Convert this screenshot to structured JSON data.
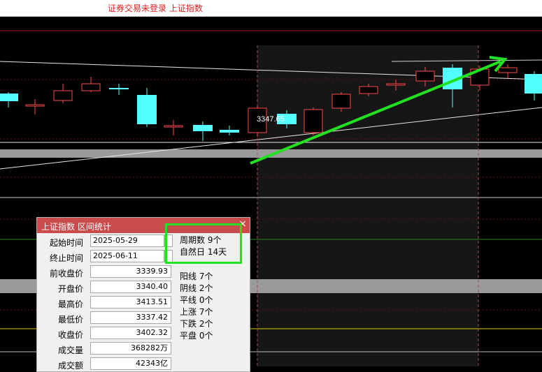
{
  "topbar": {
    "title": "证券交易未登录   上证指数"
  },
  "chart": {
    "price_label": "3347.65",
    "colors": {
      "up": "#ff4a4a",
      "down": "#54ffff",
      "highlight": "#161616",
      "arrow": "#22e022"
    },
    "candles": [
      {
        "dir": "down",
        "kind": "solid"
      },
      {
        "dir": "up",
        "kind": "hollow"
      },
      {
        "dir": "up",
        "kind": "hollow"
      },
      {
        "dir": "up",
        "kind": "hollow"
      },
      {
        "dir": "down",
        "kind": "solid"
      },
      {
        "dir": "down",
        "kind": "solid"
      },
      {
        "dir": "up",
        "kind": "hollow"
      },
      {
        "dir": "down",
        "kind": "solid"
      },
      {
        "dir": "down",
        "kind": "solid"
      },
      {
        "dir": "up",
        "kind": "hollow"
      },
      {
        "dir": "down",
        "kind": "solid"
      },
      {
        "dir": "up",
        "kind": "hollow"
      },
      {
        "dir": "up",
        "kind": "hollow"
      },
      {
        "dir": "up",
        "kind": "hollow"
      },
      {
        "dir": "up",
        "kind": "hollow"
      },
      {
        "dir": "up",
        "kind": "hollow"
      },
      {
        "dir": "down",
        "kind": "solid"
      },
      {
        "dir": "up",
        "kind": "hollow"
      },
      {
        "dir": "up",
        "kind": "hollow"
      },
      {
        "dir": "down",
        "kind": "solid"
      }
    ]
  },
  "dialog": {
    "title": "上证指数 区间统计",
    "close": "×",
    "fields": [
      {
        "label": "起始时间",
        "value": "2025-05-29",
        "type": "date"
      },
      {
        "label": "终止时间",
        "value": "2025-06-11",
        "type": "date"
      },
      {
        "label": "前收盘价",
        "value": "3339.93"
      },
      {
        "label": "开盘价",
        "value": "3340.40"
      },
      {
        "label": "最高价",
        "value": "3413.51"
      },
      {
        "label": "最低价",
        "value": "3337.42"
      },
      {
        "label": "收盘价",
        "value": "3402.32"
      },
      {
        "label": "成交量",
        "value": "368282万"
      },
      {
        "label": "成交额",
        "value": "42343亿"
      }
    ],
    "summary": [
      "周期数 9个",
      "自然日 14天"
    ],
    "counts": [
      "阳线 7个",
      "阴线 2个",
      "平线 0个",
      "上涨 7个",
      "下跌 2个",
      "平盘 0个"
    ]
  }
}
